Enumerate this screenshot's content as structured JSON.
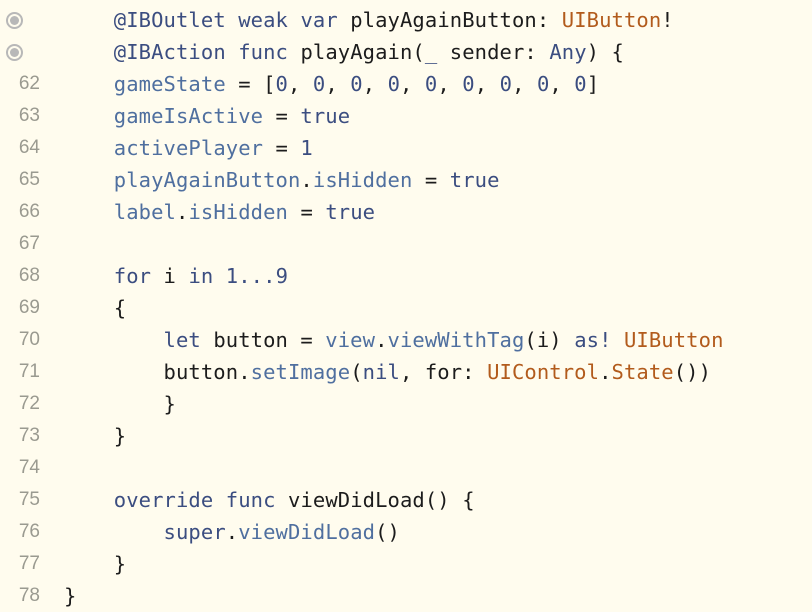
{
  "editor": {
    "lines": [
      {
        "gutter": "",
        "gutter_icon": "connection-outlet-icon",
        "tokens": [
          {
            "t": "    ",
            "c": "plain"
          },
          {
            "t": "@IBOutlet",
            "c": "attr"
          },
          {
            "t": " ",
            "c": "plain"
          },
          {
            "t": "weak",
            "c": "kw"
          },
          {
            "t": " ",
            "c": "plain"
          },
          {
            "t": "var",
            "c": "kw"
          },
          {
            "t": " playAgainButton: ",
            "c": "plain"
          },
          {
            "t": "UIButton",
            "c": "ty"
          },
          {
            "t": "!",
            "c": "plain"
          }
        ]
      },
      {
        "gutter": "",
        "gutter_icon": "connection-action-icon",
        "tokens": [
          {
            "t": "    ",
            "c": "plain"
          },
          {
            "t": "@IBAction",
            "c": "attr"
          },
          {
            "t": " ",
            "c": "plain"
          },
          {
            "t": "func",
            "c": "kw"
          },
          {
            "t": " playAgain(",
            "c": "plain"
          },
          {
            "t": "_",
            "c": "kw"
          },
          {
            "t": " sender: ",
            "c": "plain"
          },
          {
            "t": "Any",
            "c": "kw"
          },
          {
            "t": ") {",
            "c": "plain"
          }
        ]
      },
      {
        "gutter": "62",
        "tokens": [
          {
            "t": "    ",
            "c": "plain"
          },
          {
            "t": "gameState",
            "c": "var"
          },
          {
            "t": " = [",
            "c": "plain"
          },
          {
            "t": "0",
            "c": "num"
          },
          {
            "t": ", ",
            "c": "plain"
          },
          {
            "t": "0",
            "c": "num"
          },
          {
            "t": ", ",
            "c": "plain"
          },
          {
            "t": "0",
            "c": "num"
          },
          {
            "t": ", ",
            "c": "plain"
          },
          {
            "t": "0",
            "c": "num"
          },
          {
            "t": ", ",
            "c": "plain"
          },
          {
            "t": "0",
            "c": "num"
          },
          {
            "t": ", ",
            "c": "plain"
          },
          {
            "t": "0",
            "c": "num"
          },
          {
            "t": ", ",
            "c": "plain"
          },
          {
            "t": "0",
            "c": "num"
          },
          {
            "t": ", ",
            "c": "plain"
          },
          {
            "t": "0",
            "c": "num"
          },
          {
            "t": ", ",
            "c": "plain"
          },
          {
            "t": "0",
            "c": "num"
          },
          {
            "t": "]",
            "c": "plain"
          }
        ]
      },
      {
        "gutter": "63",
        "tokens": [
          {
            "t": "    ",
            "c": "plain"
          },
          {
            "t": "gameIsActive",
            "c": "var"
          },
          {
            "t": " = ",
            "c": "plain"
          },
          {
            "t": "true",
            "c": "kw"
          }
        ]
      },
      {
        "gutter": "64",
        "tokens": [
          {
            "t": "    ",
            "c": "plain"
          },
          {
            "t": "activePlayer",
            "c": "var"
          },
          {
            "t": " = ",
            "c": "plain"
          },
          {
            "t": "1",
            "c": "num"
          }
        ]
      },
      {
        "gutter": "65",
        "tokens": [
          {
            "t": "    ",
            "c": "plain"
          },
          {
            "t": "playAgainButton",
            "c": "var"
          },
          {
            "t": ".",
            "c": "plain"
          },
          {
            "t": "isHidden",
            "c": "var"
          },
          {
            "t": " = ",
            "c": "plain"
          },
          {
            "t": "true",
            "c": "kw"
          }
        ]
      },
      {
        "gutter": "66",
        "tokens": [
          {
            "t": "    ",
            "c": "plain"
          },
          {
            "t": "label",
            "c": "var"
          },
          {
            "t": ".",
            "c": "plain"
          },
          {
            "t": "isHidden",
            "c": "var"
          },
          {
            "t": " = ",
            "c": "plain"
          },
          {
            "t": "true",
            "c": "kw"
          }
        ]
      },
      {
        "gutter": "67",
        "tokens": []
      },
      {
        "gutter": "68",
        "tokens": [
          {
            "t": "    ",
            "c": "plain"
          },
          {
            "t": "for",
            "c": "kw"
          },
          {
            "t": " i ",
            "c": "plain"
          },
          {
            "t": "in",
            "c": "kw"
          },
          {
            "t": " ",
            "c": "plain"
          },
          {
            "t": "1",
            "c": "num"
          },
          {
            "t": "...",
            "c": "kw"
          },
          {
            "t": "9",
            "c": "num"
          }
        ]
      },
      {
        "gutter": "69",
        "tokens": [
          {
            "t": "    {",
            "c": "plain"
          }
        ]
      },
      {
        "gutter": "70",
        "tokens": [
          {
            "t": "        ",
            "c": "plain"
          },
          {
            "t": "let",
            "c": "kw"
          },
          {
            "t": " button = ",
            "c": "plain"
          },
          {
            "t": "view",
            "c": "fn"
          },
          {
            "t": ".",
            "c": "plain"
          },
          {
            "t": "viewWithTag",
            "c": "fn"
          },
          {
            "t": "(i) ",
            "c": "plain"
          },
          {
            "t": "as!",
            "c": "kw"
          },
          {
            "t": " ",
            "c": "plain"
          },
          {
            "t": "UIButton",
            "c": "ty"
          }
        ]
      },
      {
        "gutter": "71",
        "tokens": [
          {
            "t": "        button.",
            "c": "plain"
          },
          {
            "t": "setImage",
            "c": "fn"
          },
          {
            "t": "(",
            "c": "plain"
          },
          {
            "t": "nil",
            "c": "kw"
          },
          {
            "t": ", for: ",
            "c": "plain"
          },
          {
            "t": "UIControl",
            "c": "ty"
          },
          {
            "t": ".",
            "c": "plain"
          },
          {
            "t": "State",
            "c": "ty"
          },
          {
            "t": "())",
            "c": "plain"
          }
        ]
      },
      {
        "gutter": "72",
        "tokens": [
          {
            "t": "        }",
            "c": "plain"
          }
        ]
      },
      {
        "gutter": "73",
        "tokens": [
          {
            "t": "    }",
            "c": "plain"
          }
        ]
      },
      {
        "gutter": "74",
        "tokens": []
      },
      {
        "gutter": "75",
        "tokens": [
          {
            "t": "    ",
            "c": "plain"
          },
          {
            "t": "override",
            "c": "kw"
          },
          {
            "t": " ",
            "c": "plain"
          },
          {
            "t": "func",
            "c": "kw"
          },
          {
            "t": " viewDidLoad() {",
            "c": "plain"
          }
        ]
      },
      {
        "gutter": "76",
        "tokens": [
          {
            "t": "        ",
            "c": "plain"
          },
          {
            "t": "super",
            "c": "kw"
          },
          {
            "t": ".",
            "c": "plain"
          },
          {
            "t": "viewDidLoad",
            "c": "fn"
          },
          {
            "t": "()",
            "c": "plain"
          }
        ]
      },
      {
        "gutter": "77",
        "tokens": [
          {
            "t": "    }",
            "c": "plain"
          }
        ]
      },
      {
        "gutter": "78",
        "tokens": [
          {
            "t": "}",
            "c": "plain"
          }
        ]
      }
    ]
  }
}
